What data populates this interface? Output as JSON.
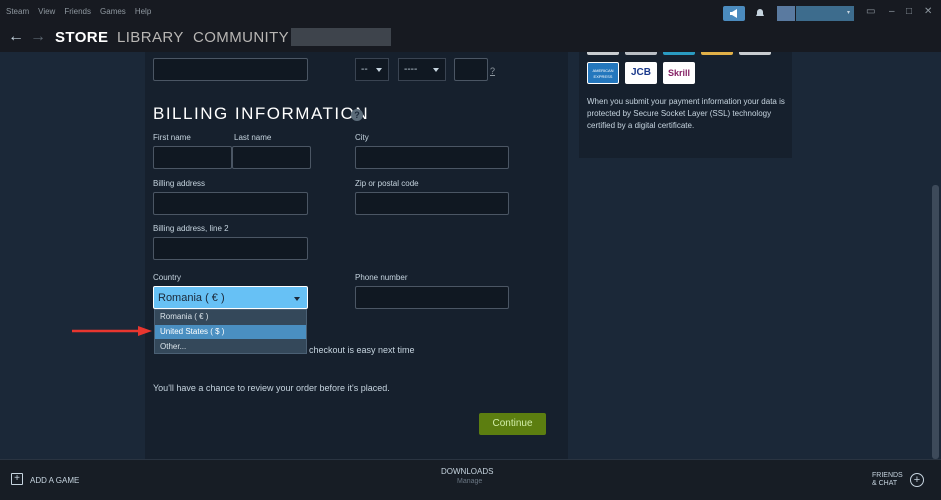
{
  "menu": [
    "Steam",
    "View",
    "Friends",
    "Games",
    "Help"
  ],
  "titlebar": {
    "user_label": "▾"
  },
  "window_controls": {
    "screenshot_icon": "▭",
    "minimize": "–",
    "maximize": "□",
    "close": "✕"
  },
  "nav": {
    "back": "←",
    "forward": "→",
    "store": "STORE",
    "library": "LIBRARY",
    "community": "COMMUNITY"
  },
  "expiry": {
    "month": "--",
    "year": "----",
    "help": "?"
  },
  "billing": {
    "heading": "BILLING INFORMATION",
    "help": "?",
    "first_name_label": "First name",
    "last_name_label": "Last name",
    "city_label": "City",
    "address_label": "Billing address",
    "zip_label": "Zip or postal code",
    "address2_label": "Billing address, line 2",
    "country_label": "Country",
    "phone_label": "Phone number",
    "country_value": "Romania ( € )"
  },
  "dropdown": {
    "options": [
      "Romania ( € )",
      "United States ( $ )",
      "Other..."
    ],
    "selected_index": 1
  },
  "checkout_text": "checkout is easy next time",
  "review_text": "You'll have a chance to review your order before it's placed.",
  "continue_label": "Continue",
  "payment_icons": {
    "amex": "AMERICAN EXPRESS",
    "jcb": "JCB",
    "skrill": "Skrill"
  },
  "secure_text": "When you submit your payment information your data is protected by Secure Socket Layer (SSL) technology certified by a digital certificate.",
  "bottom": {
    "add_game": "ADD A GAME",
    "downloads": "DOWNLOADS",
    "manage": "Manage",
    "friends_line1": "FRIENDS",
    "friends_line2": "& CHAT"
  },
  "colors": {
    "accent": "#67c1f5",
    "continue": "#5c7e10",
    "background": "#1b2838",
    "panel": "#16202d",
    "arrow": "#e8362f"
  }
}
